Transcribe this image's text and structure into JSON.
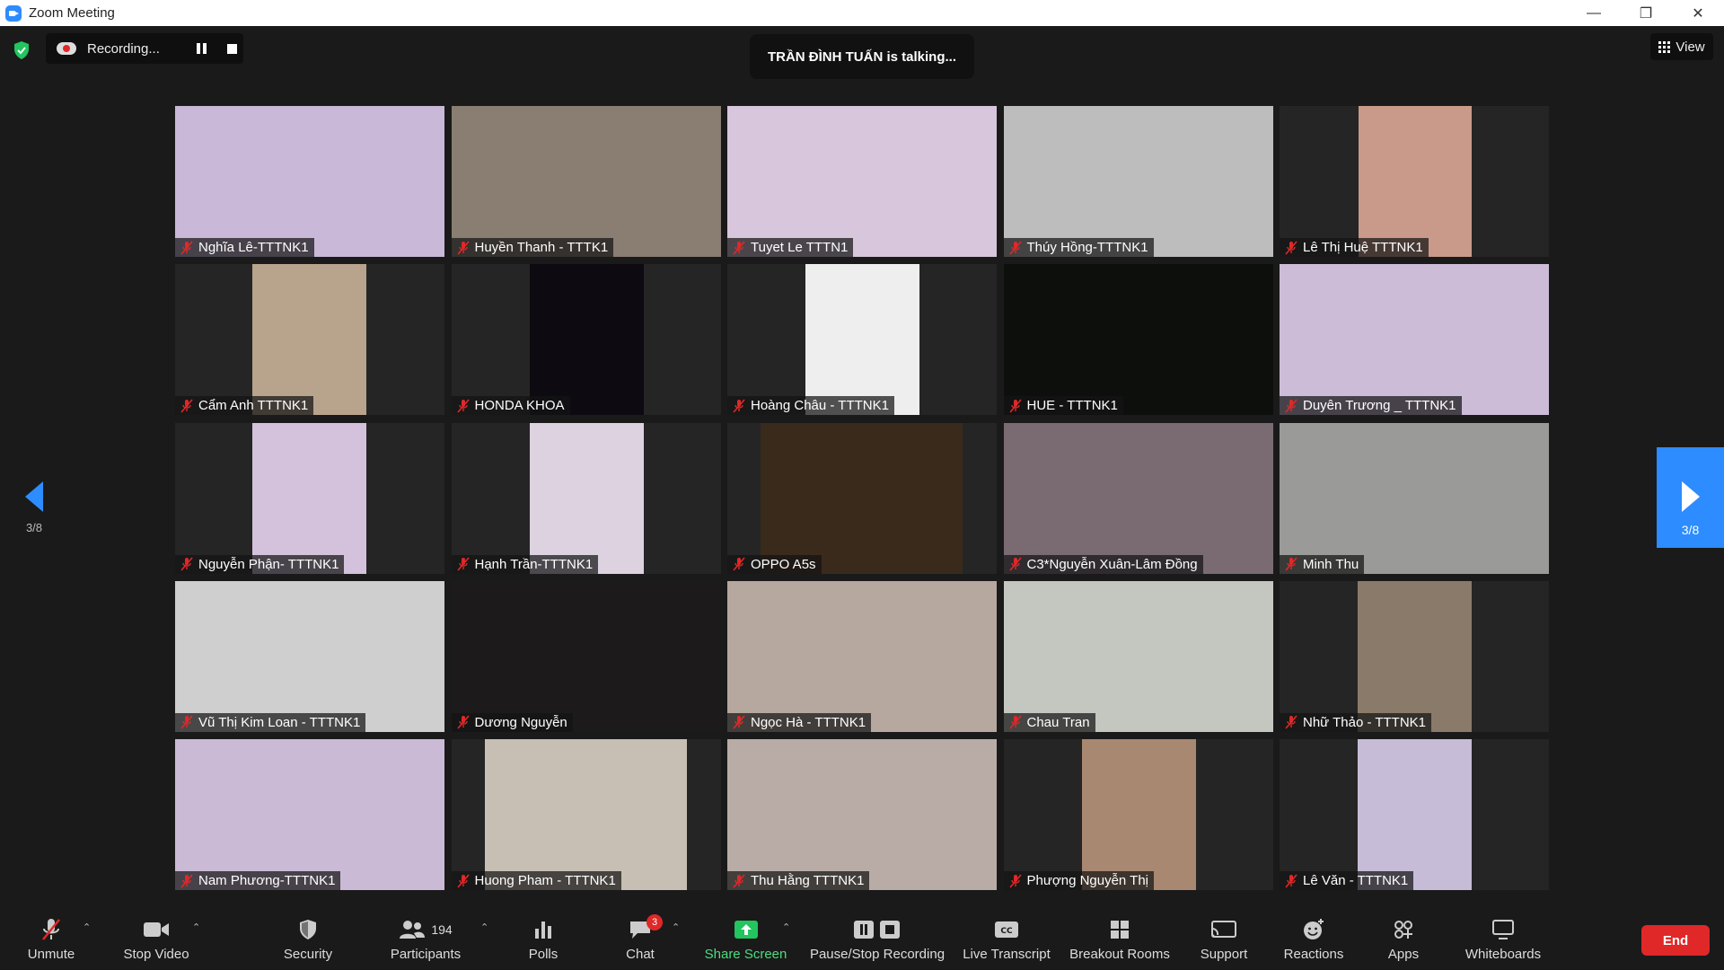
{
  "window": {
    "title": "Zoom Meeting"
  },
  "recording": {
    "label": "Recording..."
  },
  "talking": "TRẦN ĐÌNH TUẤN is talking...",
  "view": {
    "label": "View"
  },
  "pager": {
    "left": "3/8",
    "right": "3/8"
  },
  "participants": [
    {
      "name": "Nghĩa Lê-TTTNK1",
      "bg": "#c9b8d8",
      "vx": 0,
      "vw": 300
    },
    {
      "name": "Huyền Thanh - TTTK1",
      "bg": "#8a7d72",
      "vx": 0,
      "vw": 300
    },
    {
      "name": "Tuyet Le TTTN1",
      "bg": "#d8c6dc",
      "vx": 0,
      "vw": 300
    },
    {
      "name": "Thúy Hồng-TTTNK1",
      "bg": "#bdbdbd",
      "vx": 0,
      "vw": 300
    },
    {
      "name": "Lê Thị Huệ TTTNK1",
      "bg": "#c99a8a",
      "vx": 88,
      "vw": 126
    },
    {
      "name": "Cẩm Anh TTTNK1",
      "bg": "#b8a38d",
      "vx": 86,
      "vw": 127
    },
    {
      "name": "HONDA KHOA",
      "bg": "#0d0a12",
      "vx": 87,
      "vw": 127
    },
    {
      "name": "Hoàng Châu - TTTNK1",
      "bg": "#eeeeee",
      "vx": 87,
      "vw": 127
    },
    {
      "name": "HUE - TTTNK1",
      "bg": "#0c0f0c",
      "vx": 0,
      "vw": 300
    },
    {
      "name": "Duyên Trương _ TTTNK1",
      "bg": "#cdbcd8",
      "vx": 0,
      "vw": 300
    },
    {
      "name": "Nguyễn Phận- TTTNK1",
      "bg": "#d4c2dc",
      "vx": 86,
      "vw": 127
    },
    {
      "name": "Hạnh Trần-TTTNK1",
      "bg": "#dcd2e0",
      "vx": 87,
      "vw": 127
    },
    {
      "name": "OPPO A5s",
      "bg": "#3a2a1c",
      "vx": 37,
      "vw": 225
    },
    {
      "name": "C3*Nguyễn Xuân-Lâm Đồng",
      "bg": "#7a6a72",
      "vx": 0,
      "vw": 300
    },
    {
      "name": "Minh Thu",
      "bg": "#9a9a98",
      "vx": 0,
      "vw": 300
    },
    {
      "name": "Vũ Thị Kim Loan - TTTNK1",
      "bg": "#cfcfcf",
      "vx": 0,
      "vw": 300
    },
    {
      "name": "Dương Nguyễn",
      "bg": "#1c1a1a",
      "vx": 0,
      "vw": 300
    },
    {
      "name": "Ngọc Hà - TTTNK1",
      "bg": "#b6a89e",
      "vx": 0,
      "vw": 300
    },
    {
      "name": "Chau Tran",
      "bg": "#c4c6c0",
      "vx": 0,
      "vw": 300
    },
    {
      "name": "Nhữ Thảo - TTTNK1",
      "bg": "#8a7a6a",
      "vx": 87,
      "vw": 127
    },
    {
      "name": "Nam Phương-TTTNK1",
      "bg": "#cbbad6",
      "vx": 0,
      "vw": 300
    },
    {
      "name": "Huong Pham - TTTNK1",
      "bg": "#c8bfb4",
      "vx": 37,
      "vw": 225
    },
    {
      "name": "Thu Hằng TTTNK1",
      "bg": "#b9aca6",
      "vx": 0,
      "vw": 300
    },
    {
      "name": "Phượng Nguyễn Thị",
      "bg": "#a88870",
      "vx": 87,
      "vw": 127
    },
    {
      "name": "Lê Văn - TTTNK1",
      "bg": "#c6bcd8",
      "vx": 87,
      "vw": 127
    }
  ],
  "toolbar": {
    "unmute": "Unmute",
    "stop_video": "Stop Video",
    "security": "Security",
    "participants": "Participants",
    "participants_count": "194",
    "polls": "Polls",
    "chat": "Chat",
    "chat_badge": "3",
    "share_screen": "Share Screen",
    "pause_stop_recording": "Pause/Stop Recording",
    "live_transcript": "Live Transcript",
    "breakout_rooms": "Breakout Rooms",
    "support": "Support",
    "reactions": "Reactions",
    "apps": "Apps",
    "whiteboards": "Whiteboards",
    "end": "End"
  },
  "colors": {
    "accent": "#2d8cff",
    "end": "#e02828",
    "share": "#4ade80",
    "muted_mic": "#e02828"
  }
}
